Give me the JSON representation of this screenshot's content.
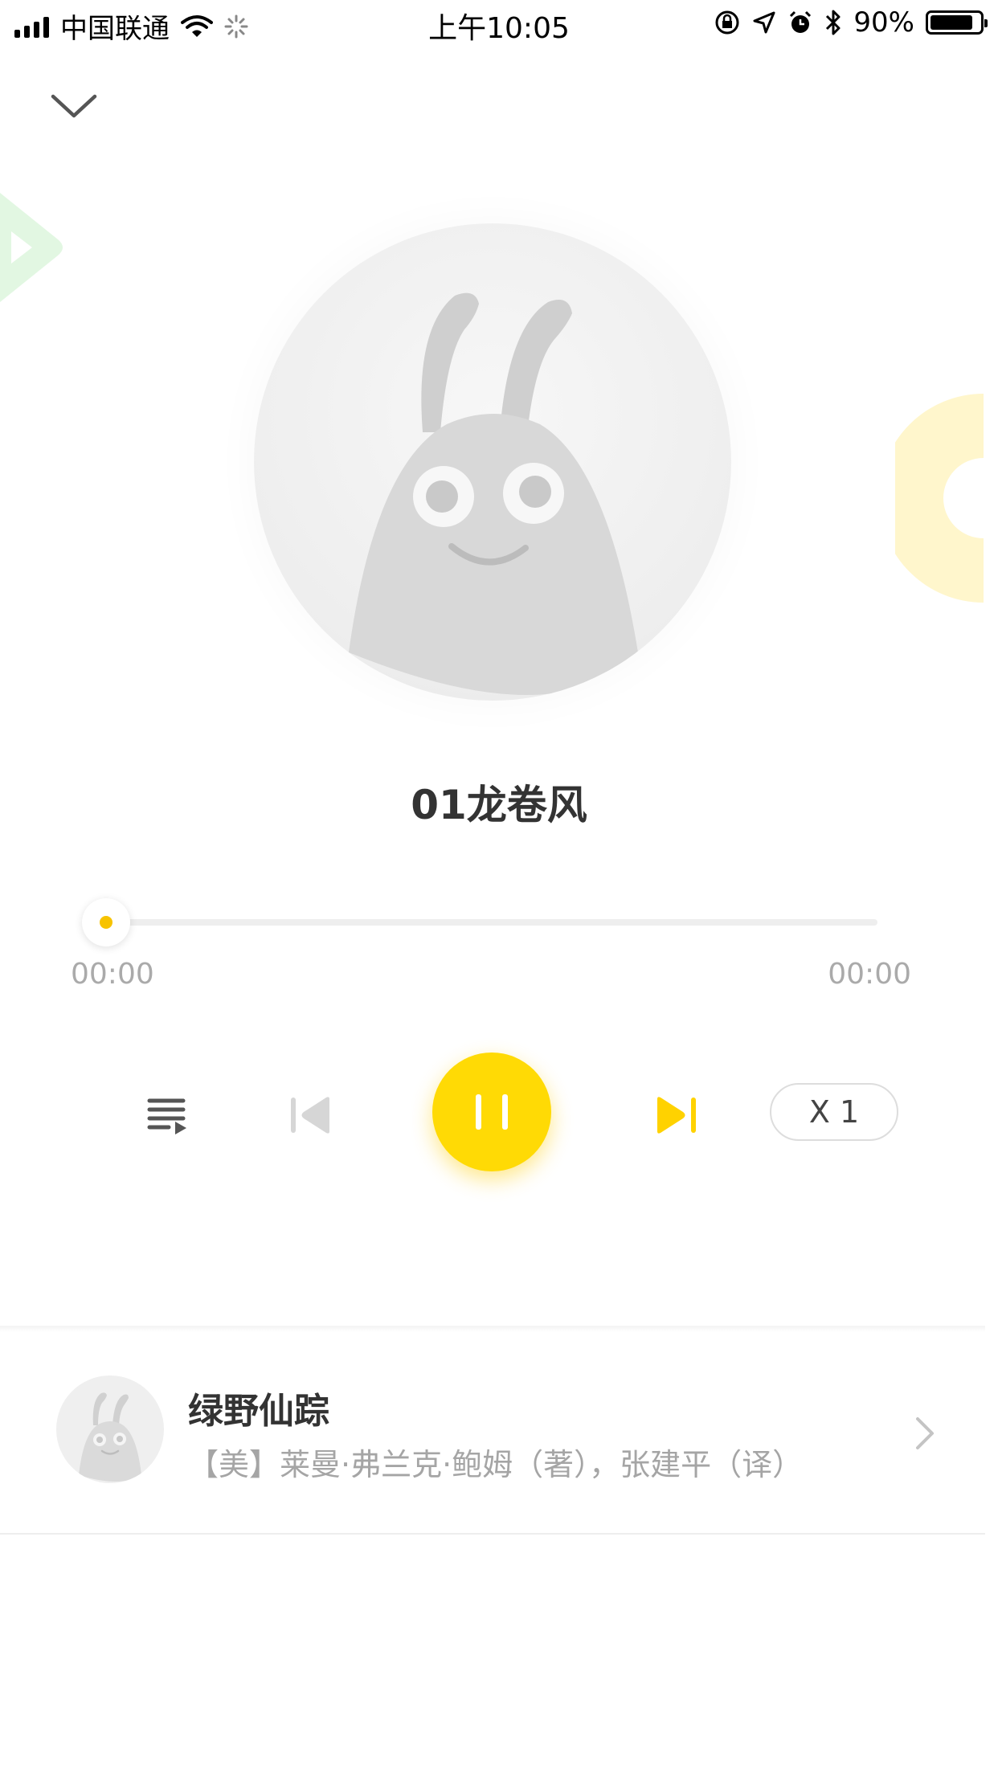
{
  "status_bar": {
    "carrier": "中国联通",
    "time": "上午10:05",
    "battery_text": "90%",
    "battery_level": 0.9,
    "icons": [
      "signal-icon",
      "wifi-icon",
      "loading-icon",
      "orientation-lock-icon",
      "location-icon",
      "alarm-icon",
      "bluetooth-icon",
      "battery-icon"
    ]
  },
  "header": {
    "collapse_icon": "chevron-down-icon"
  },
  "player": {
    "track_title": "01龙卷风",
    "current_time": "00:00",
    "total_time": "00:00",
    "progress": 0,
    "speed_label": "X 1",
    "state": "playing",
    "icons": [
      "playlist-icon",
      "previous-icon",
      "pause-icon",
      "next-icon"
    ]
  },
  "book": {
    "title": "绿野仙踪",
    "author": "【美】莱曼·弗兰克·鲍姆（著），张建平（译）"
  },
  "colors": {
    "accent": "#ffda05",
    "progress_dot": "#f7c300",
    "text_primary": "#333333",
    "text_secondary": "#a5a5a5",
    "deco_green": "#e2f7e2",
    "deco_yellow": "#fff6cc"
  }
}
